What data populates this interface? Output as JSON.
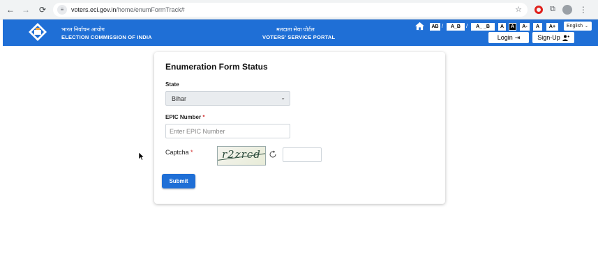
{
  "browser": {
    "url_host": "voters.eci.gov.in",
    "url_path": "/home/enumFormTrack#"
  },
  "header": {
    "eci_hindi": "भारत निर्वाचन आयोग",
    "eci_english": "ELECTION COMMISSION OF INDIA",
    "portal_hindi": "मतदाता सेवा पोर्टल",
    "portal_english": "VOTERS' SERVICE PORTAL",
    "contrast_options": [
      "AB",
      "A_B",
      "A_ _B"
    ],
    "font_size_options": [
      "A",
      "A",
      "A-",
      "A",
      "A+"
    ],
    "language": "English",
    "login_label": "Login",
    "signup_label": "Sign-Up"
  },
  "form": {
    "title": "Enumeration Form Status",
    "state_label": "State",
    "state_value": "Bihar",
    "epic_label": "EPIC Number",
    "epic_required": "*",
    "epic_placeholder": "Enter EPIC Number",
    "captcha_label": "Captcha",
    "captcha_required": "*",
    "captcha_text": "r2zrcd",
    "submit_label": "Submit"
  },
  "colors": {
    "header_blue": "#1f6fd6",
    "required_red": "#d32f2f"
  }
}
